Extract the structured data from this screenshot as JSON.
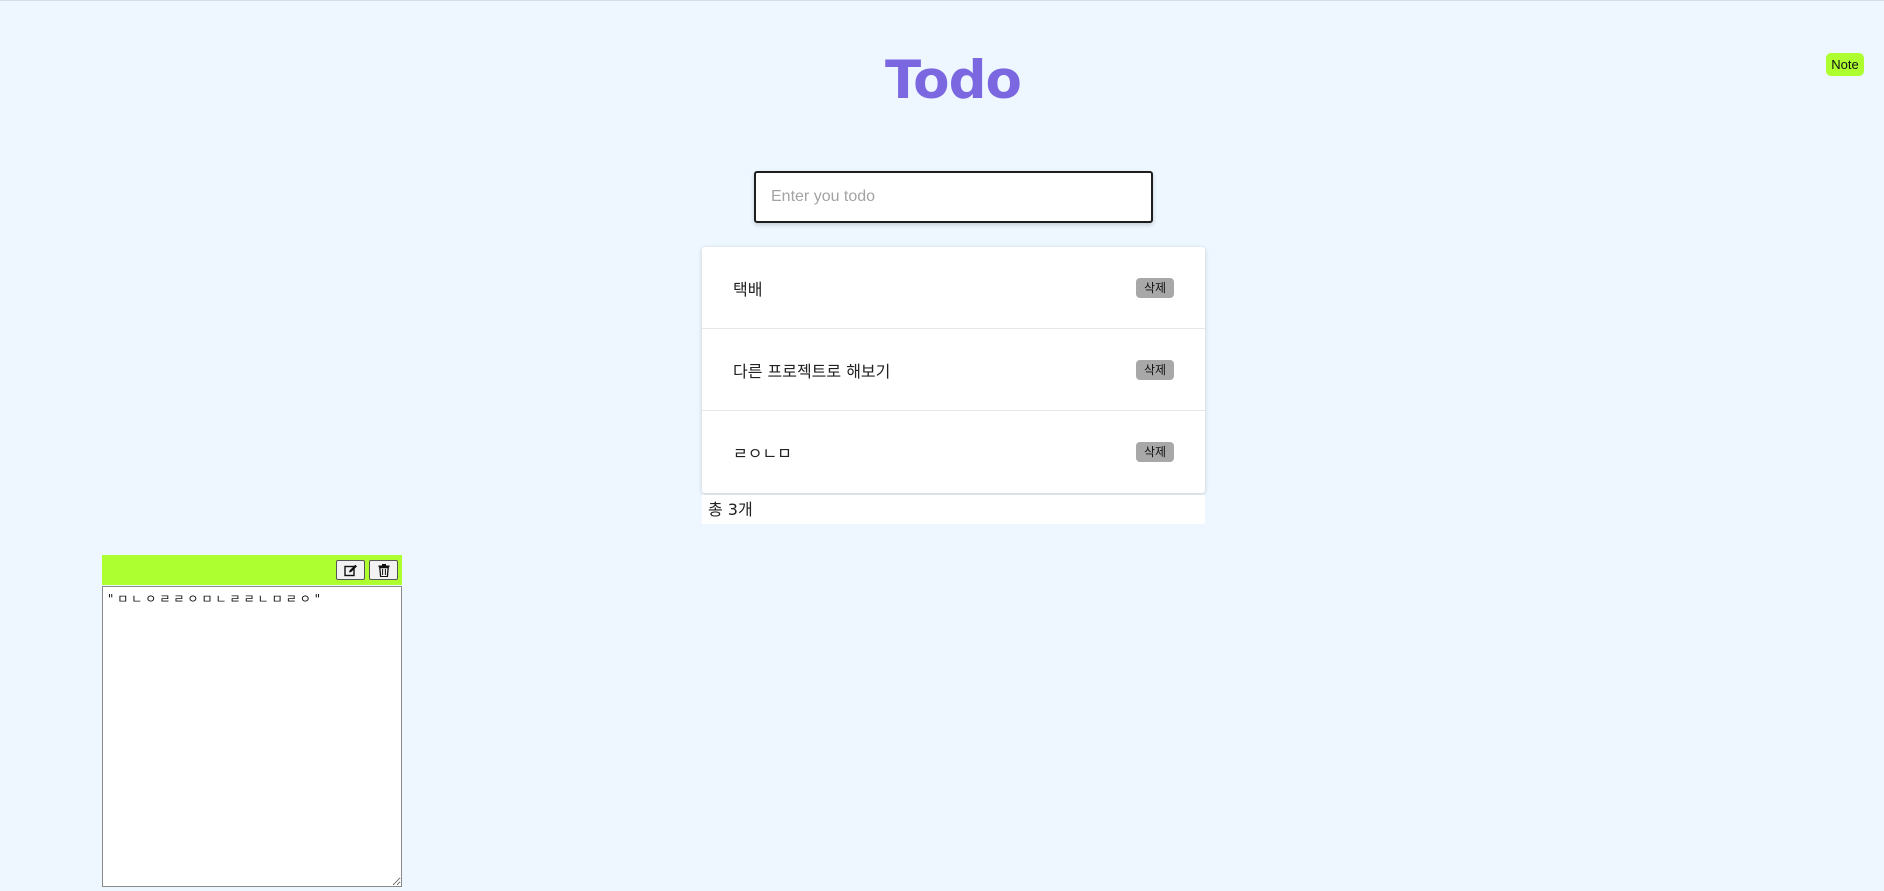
{
  "app": {
    "title": "Todo",
    "note_button_label": "Note"
  },
  "input": {
    "placeholder": "Enter you todo",
    "value": ""
  },
  "todos": [
    {
      "text": "택배",
      "delete_label": "삭제"
    },
    {
      "text": "다른 프로젝트로 해보기",
      "delete_label": "삭제"
    },
    {
      "text": "ㄹㅇㄴㅁ",
      "delete_label": "삭제"
    }
  ],
  "footer": {
    "count_text": "총 3개"
  },
  "note": {
    "content": "\"ㅁㄴㅇㄹㄹㅇㅁㄴㄹㄹㄴㅁㄹㅇ\"",
    "edit_icon": "edit-icon",
    "delete_icon": "trash-icon"
  },
  "colors": {
    "background": "#eef7ff",
    "title": "#7b68e0",
    "accent": "#adff2f",
    "delete_button": "#a8a8a8"
  }
}
